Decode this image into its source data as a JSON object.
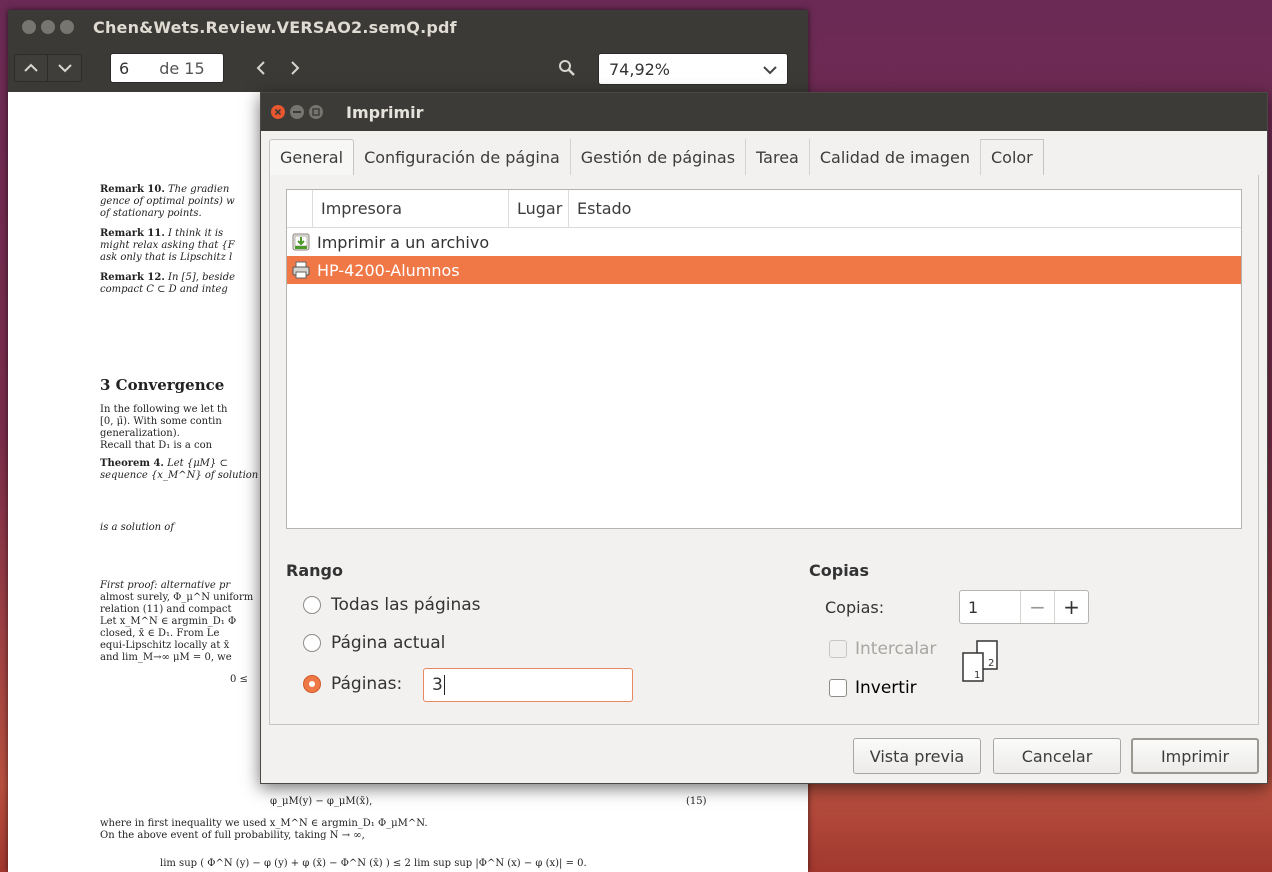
{
  "viewer": {
    "title": "Chen&Wets.Review.VERSAO2.semQ.pdf",
    "page_current": "6",
    "page_of": "de 15",
    "zoom": "74,92%",
    "icons": {
      "up": "chevron-up-icon",
      "down": "chevron-down-icon",
      "prev": "chevron-left-icon",
      "next": "chevron-right-icon",
      "search": "search-icon",
      "zoom_dropdown": "chevron-down-icon"
    }
  },
  "paper": {
    "lines": [
      {
        "bold": "Remark 10.",
        "text": " The gradien"
      },
      {
        "bold": "",
        "text": "gence of optimal points) w"
      },
      {
        "bold": "",
        "text": "of stationary points."
      },
      {
        "bold": "Remark 11.",
        "text": " I think it is"
      },
      {
        "bold": "",
        "text": "might relax asking that {F"
      },
      {
        "bold": "",
        "text": "ask only that is Lipschitz l"
      },
      {
        "bold": "Remark 12.",
        "text": " In [5], beside"
      },
      {
        "bold": "",
        "text": "compact C ⊂ D and integ"
      },
      {
        "bold": "",
        "text": "In the following we let th"
      },
      {
        "bold": "",
        "text": "[0, μ̄). With some contin"
      },
      {
        "bold": "",
        "text": "generalization)."
      },
      {
        "bold": "",
        "text": "    Recall that D₁ is a con"
      },
      {
        "bold": "Theorem 4.",
        "text": " Let {μM} ⊂"
      },
      {
        "bold": "",
        "text": "sequence {x_M^N} of solution"
      },
      {
        "bold": "",
        "text": "is a solution of"
      },
      {
        "bold": "",
        "text": "First proof: alternative pr"
      },
      {
        "bold": "",
        "text": "almost surely, Φ_μ^N uniform"
      },
      {
        "bold": "",
        "text": "relation (11) and compact"
      },
      {
        "bold": "",
        "text": "    Let x_M^N ∈ argmin_D₁ Φ"
      },
      {
        "bold": "",
        "text": "closed, x̄ ∈ D₁. From Le"
      },
      {
        "bold": "",
        "text": "equi-Lipschitz locally at x̄"
      },
      {
        "bold": "",
        "text": "and lim_M→∞ μM = 0, we"
      },
      {
        "bold": "",
        "text": "φ_μM(y) − φ_μM(x̄),"
      },
      {
        "bold": "",
        "text": "where in first inequality we used x_M^N ∈ argmin_D₁ Φ_μM^N."
      },
      {
        "bold": "",
        "text": "    On the above event of full probability, taking N → ∞,"
      },
      {
        "bold": "",
        "text": "lim sup ( Φ^N (y) − φ (y) + φ (x̄) − Φ^N (x̄) ) ≤ 2 lim sup sup |Φ^N (x) − φ (x)| = 0."
      }
    ],
    "section": "3   Convergence",
    "eq_zero": "0  ≤",
    "eq_number": "(15)"
  },
  "dialog": {
    "title": "Imprimir",
    "tabs": [
      "General",
      "Configuración de página",
      "Gestión de páginas",
      "Tarea",
      "Calidad de imagen",
      "Color"
    ],
    "columns": [
      "Impresora",
      "Lugar",
      "Estado"
    ],
    "printers": [
      {
        "name": "Imprimir a un archivo",
        "icon": "file-download-icon",
        "selected": false
      },
      {
        "name": "HP-4200-Alumnos",
        "icon": "printer-icon",
        "selected": true
      }
    ],
    "range": {
      "title": "Rango",
      "all_pages": "Todas las páginas",
      "current_page": "Página actual",
      "pages": "Páginas:",
      "pages_value": "3",
      "selected": "pages"
    },
    "copies": {
      "title": "Copias",
      "label": "Copias:",
      "value": "1",
      "minus": "−",
      "plus": "+",
      "collate": "Intercalar",
      "reverse": "Invertir",
      "collate_enabled": false
    },
    "buttons": {
      "preview": "Vista previa",
      "cancel": "Cancelar",
      "print": "Imprimir"
    },
    "accent_color": "#f07746"
  }
}
